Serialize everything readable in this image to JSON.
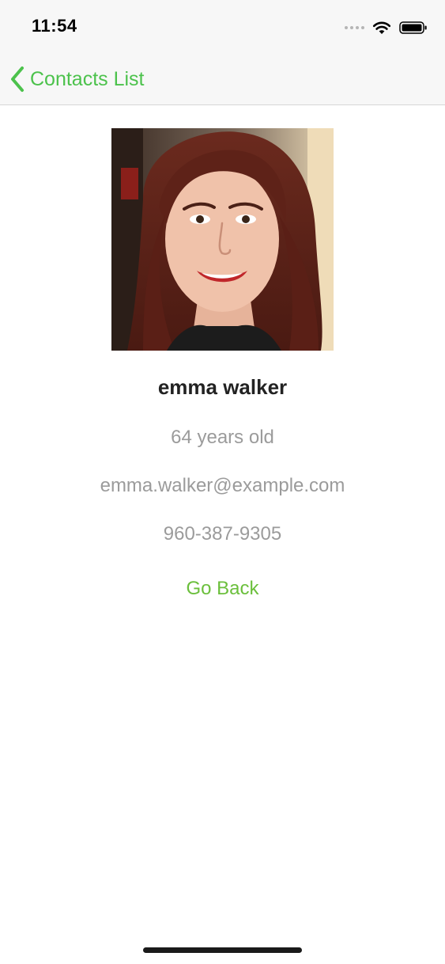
{
  "status_bar": {
    "time": "11:54",
    "icons": [
      "signal-dots-icon",
      "wifi-icon",
      "battery-icon"
    ]
  },
  "nav": {
    "back_label": "Contacts List",
    "back_icon": "chevron-left-icon",
    "accent_color": "#4cc24c"
  },
  "contact": {
    "photo": "person-photo",
    "name": "emma walker",
    "age": "64 years old",
    "email": "emma.walker@example.com",
    "phone": "960-387-9305"
  },
  "actions": {
    "go_back_label": "Go Back",
    "go_back_color": "#6bbf3c"
  }
}
